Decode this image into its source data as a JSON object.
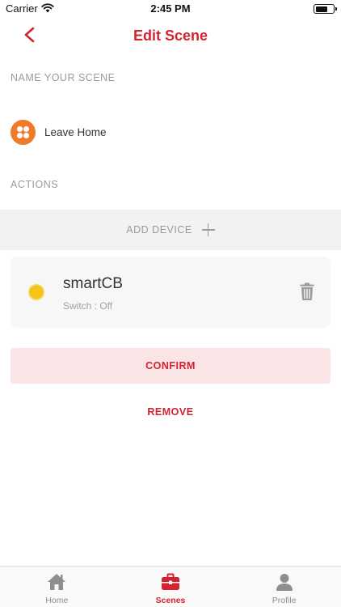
{
  "status_bar": {
    "carrier": "Carrier",
    "time": "2:45 PM"
  },
  "header": {
    "title": "Edit Scene",
    "back_icon": "chevron-left-icon"
  },
  "name_section": {
    "label": "NAME YOUR SCENE",
    "scene_name": "Leave Home",
    "scene_icon": "four-dots-icon",
    "scene_icon_color": "#f07a2a"
  },
  "actions_section": {
    "label": "ACTIONS",
    "add_device_label": "ADD DEVICE"
  },
  "devices": [
    {
      "name": "smartCB",
      "status": "Switch : Off",
      "icon": "bulb-icon"
    }
  ],
  "buttons": {
    "confirm": "CONFIRM",
    "remove": "REMOVE"
  },
  "tabs": [
    {
      "label": "Home",
      "icon": "home-icon",
      "active": false
    },
    {
      "label": "Scenes",
      "icon": "briefcase-icon",
      "active": true
    },
    {
      "label": "Profile",
      "icon": "person-icon",
      "active": false
    }
  ],
  "colors": {
    "accent": "#d32330",
    "confirm_bg": "#fbe4e5",
    "section_label": "#9a9a9a"
  }
}
